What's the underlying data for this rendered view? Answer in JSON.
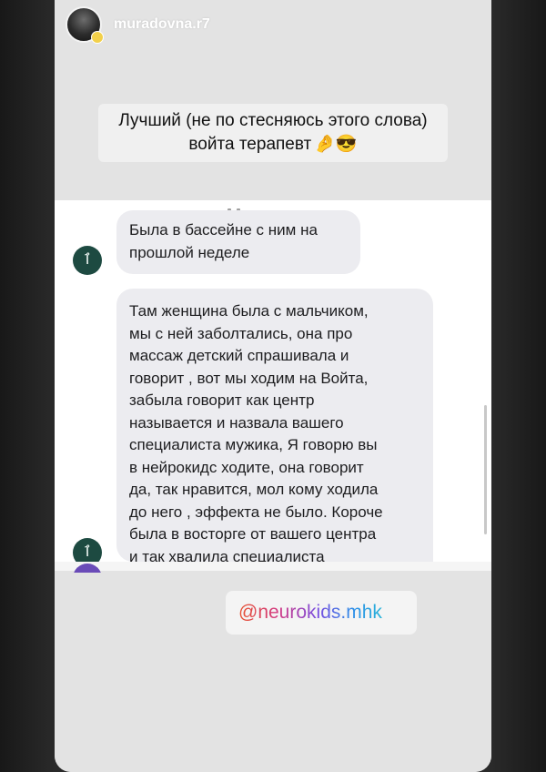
{
  "story": {
    "username": "muradovna.r7",
    "caption_line1": "Лучший (не по стесняюсь этого слова)",
    "caption_line2": "войта терапевт",
    "caption_emoji": "🤌😎",
    "mention": "@neurokids.mhk"
  },
  "chat": {
    "sender_avatar_glyph": "ٱ",
    "messages": [
      {
        "lines": [
          "Была в бассейне с ним на",
          "прошлой неделе"
        ]
      },
      {
        "lines": [
          "Там женщина была с мальчиком,",
          "мы с ней заболтались, она про",
          "массаж детский спрашивала и",
          "говорит , вот мы ходим на Войта,",
          "забыла говорит как центр",
          "называется и назвала вашего",
          "специалиста мужика, Я говорю вы",
          "в нейрокидс ходите, она говорит",
          "да, так нравится, мол кому ходила",
          "до него , эффекта не было. Короче",
          "была в восторге от вашего центра",
          "и так хвалила специалиста"
        ]
      }
    ]
  },
  "colors": {
    "story_background": "#e3e3e3",
    "bubble_background": "#ececf0",
    "avatar_green": "#1d4a41"
  }
}
